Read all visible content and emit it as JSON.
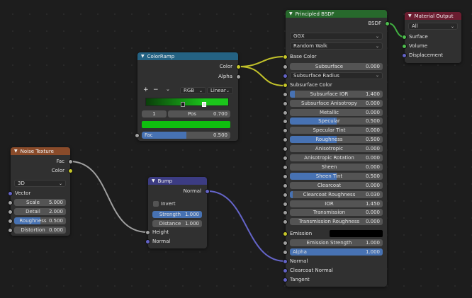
{
  "noise": {
    "title": "Noise Texture",
    "outputs": [
      "Fac",
      "Color"
    ],
    "dimension": "3D",
    "vector_label": "Vector",
    "fields": [
      {
        "label": "Scale",
        "value": "5.000",
        "fill": 0
      },
      {
        "label": "Detail",
        "value": "2.000",
        "fill": 0
      },
      {
        "label": "Roughness",
        "value": "0.500",
        "fill": 0.5
      },
      {
        "label": "Distortion",
        "value": "0.000",
        "fill": 0
      }
    ]
  },
  "colorramp": {
    "title": "ColorRamp",
    "outputs": [
      "Color",
      "Alpha"
    ],
    "add_label": "+",
    "remove_label": "−",
    "color_mode": "RGB",
    "interpolation": "Linear",
    "stop_index": "1",
    "pos_label": "Pos",
    "pos_value": "0.700",
    "fac_label": "Fac",
    "fac_value": "0.500",
    "fac_fill": 0.5,
    "ramp_colors": [
      "#0a3d0a",
      "#1bc51b"
    ],
    "stop_color": "#0fbf0f"
  },
  "bump": {
    "title": "Bump",
    "output": "Normal",
    "invert_label": "Invert",
    "strength_label": "Strength",
    "strength_value": "1.000",
    "distance_label": "Distance",
    "distance_value": "1.000",
    "inputs": [
      "Height",
      "Normal"
    ]
  },
  "bsdf": {
    "title": "Principled BSDF",
    "output": "BSDF",
    "distribution": "GGX",
    "subsurface_method": "Random Walk",
    "base_color_label": "Base Color",
    "fields": [
      {
        "label": "Subsurface",
        "value": "0.000",
        "fill": 0,
        "socket": "gray"
      },
      {
        "label": "Subsurface Radius",
        "value": "",
        "fill": 0,
        "socket": "purple",
        "dropdown": true
      },
      {
        "label": "Subsurface Color",
        "value": "",
        "fill": 0,
        "socket": "yellow",
        "plain": true
      },
      {
        "label": "Subsurface IOR",
        "value": "1.400",
        "fill": 0.05,
        "socket": "gray"
      },
      {
        "label": "Subsurface Anisotropy",
        "value": "0.000",
        "fill": 0,
        "socket": "gray"
      },
      {
        "label": "Metallic",
        "value": "0.000",
        "fill": 0,
        "socket": "gray"
      },
      {
        "label": "Specular",
        "value": "0.500",
        "fill": 0.5,
        "socket": "gray"
      },
      {
        "label": "Specular Tint",
        "value": "0.000",
        "fill": 0,
        "socket": "gray"
      },
      {
        "label": "Roughness",
        "value": "0.500",
        "fill": 0.5,
        "socket": "gray"
      },
      {
        "label": "Anisotropic",
        "value": "0.000",
        "fill": 0,
        "socket": "gray"
      },
      {
        "label": "Anisotropic Rotation",
        "value": "0.000",
        "fill": 0,
        "socket": "gray"
      },
      {
        "label": "Sheen",
        "value": "0.000",
        "fill": 0,
        "socket": "gray"
      },
      {
        "label": "Sheen Tint",
        "value": "0.500",
        "fill": 0.5,
        "socket": "gray"
      },
      {
        "label": "Clearcoat",
        "value": "0.000",
        "fill": 0,
        "socket": "gray"
      },
      {
        "label": "Clearcoat Roughness",
        "value": "0.030",
        "fill": 0.03,
        "socket": "gray"
      },
      {
        "label": "IOR",
        "value": "1.450",
        "fill": 0,
        "socket": "gray"
      },
      {
        "label": "Transmission",
        "value": "0.000",
        "fill": 0,
        "socket": "gray"
      },
      {
        "label": "Transmission Roughness",
        "value": "0.000",
        "fill": 0,
        "socket": "gray"
      }
    ],
    "emission_label": "Emission",
    "emission_color": "#000000",
    "emission_strength_label": "Emission Strength",
    "emission_strength_value": "1.000",
    "alpha_label": "Alpha",
    "alpha_value": "1.000",
    "alpha_fill": 1,
    "vector_inputs": [
      "Normal",
      "Clearcoat Normal",
      "Tangent"
    ]
  },
  "output": {
    "title": "Material Output",
    "target": "All",
    "inputs": [
      "Surface",
      "Volume",
      "Displacement"
    ]
  },
  "colors": {
    "noise_header": "#8a4b2a",
    "colorramp_header": "#246283",
    "bump_header": "#3c3c83",
    "bsdf_header": "#27692c",
    "output_header": "#6b1d30",
    "link_yellow": "#c2c22a",
    "link_gray": "#a0a0a0",
    "link_purple": "#6464c8",
    "link_green": "#41b041"
  }
}
